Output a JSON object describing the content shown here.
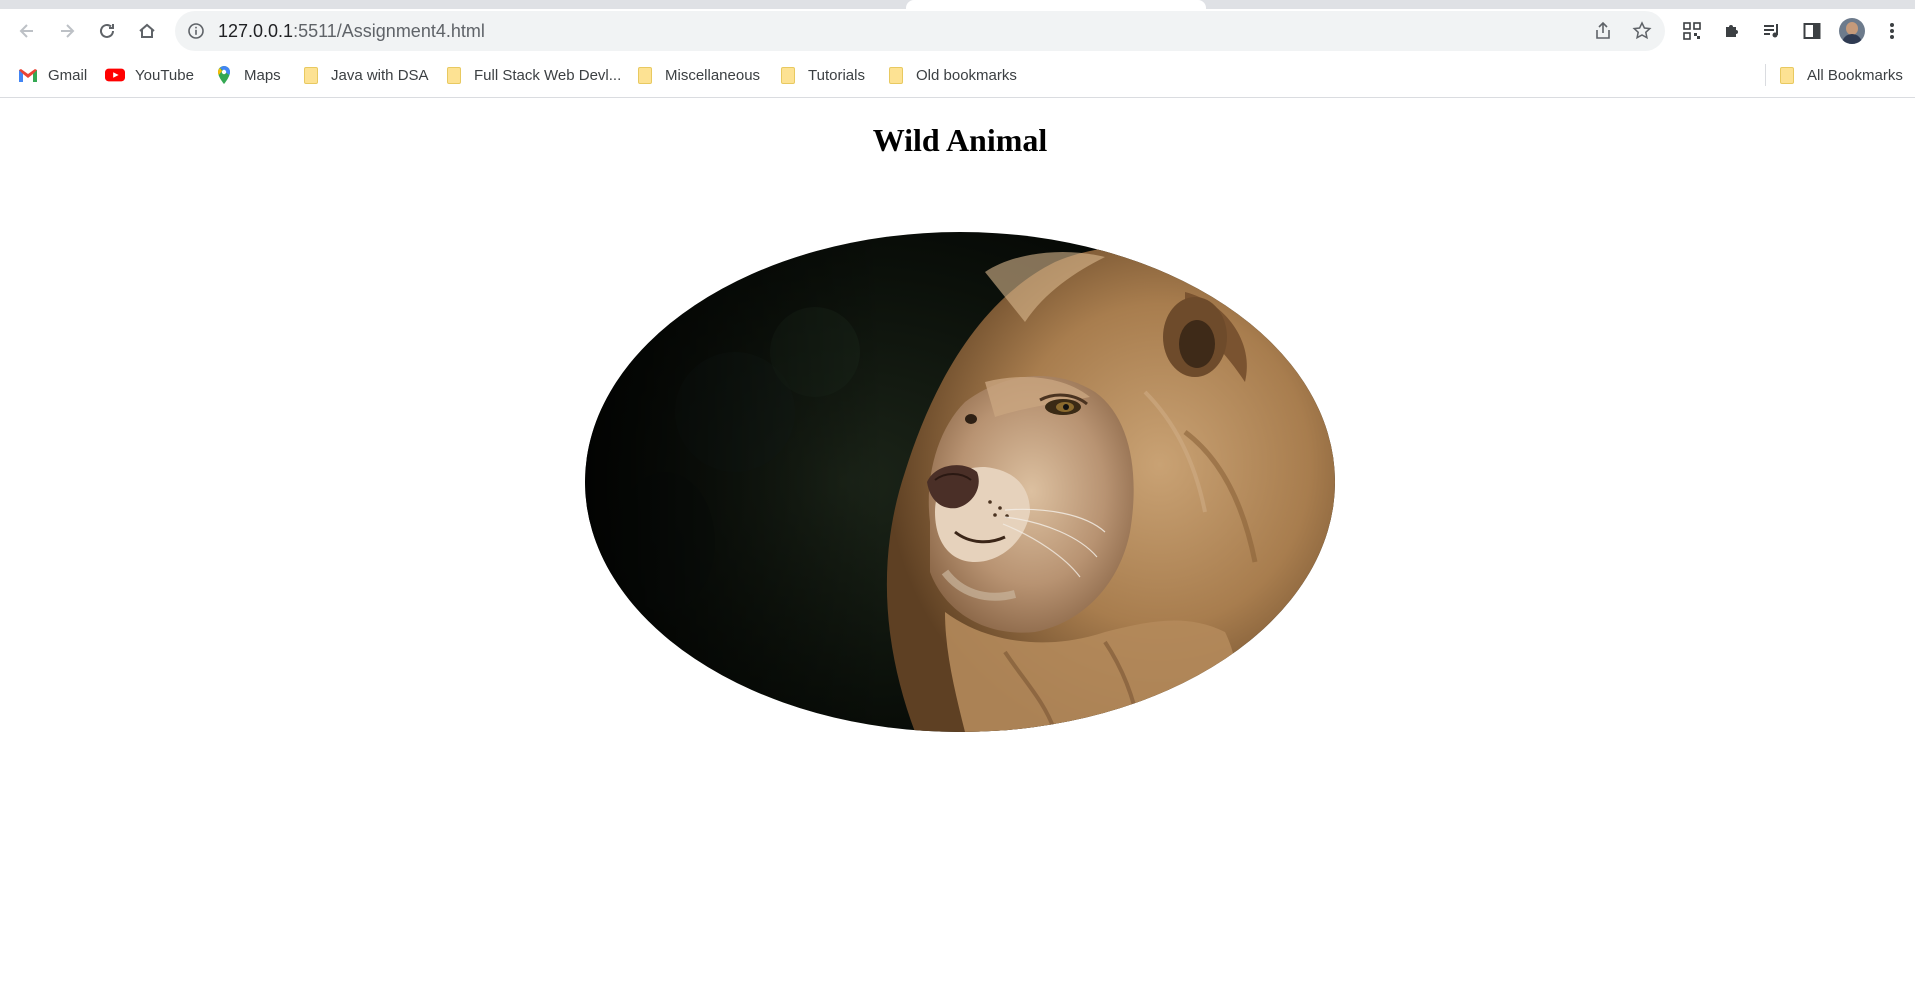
{
  "browser": {
    "url_host": "127.0.0.1",
    "url_path": ":5511/Assignment4.html",
    "bookmarks": [
      {
        "label": "Gmail",
        "icon": "gmail-icon"
      },
      {
        "label": "YouTube",
        "icon": "youtube-icon"
      },
      {
        "label": "Maps",
        "icon": "maps-icon"
      },
      {
        "label": "Java with DSA",
        "icon": "folder-icon"
      },
      {
        "label": "Full Stack Web Devl...",
        "icon": "folder-icon"
      },
      {
        "label": "Miscellaneous",
        "icon": "folder-icon"
      },
      {
        "label": "Tutorials",
        "icon": "folder-icon"
      },
      {
        "label": "Old bookmarks",
        "icon": "folder-icon"
      }
    ],
    "all_bookmarks_label": "All Bookmarks"
  },
  "page": {
    "heading": "Wild Animal",
    "image_subject": "lion"
  },
  "colors": {
    "omnibox_bg": "#f1f3f4",
    "folder": "#fde293",
    "youtube_red": "#ff0000"
  }
}
